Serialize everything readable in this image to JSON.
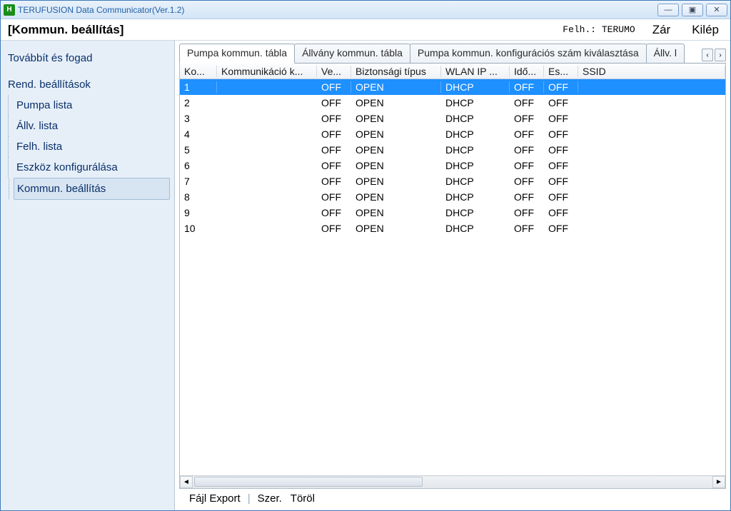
{
  "titlebar": {
    "app_icon_letter": "H",
    "title": "TERUFUSION Data Communicator(Ver.1.2)",
    "min": "—",
    "max": "▣",
    "close": "✕"
  },
  "header": {
    "heading": "[Kommun. beállítás]",
    "user_label": "Felh.: TERUMO",
    "close_btn": "Zár",
    "exit_btn": "Kilép"
  },
  "sidebar": {
    "group1": "Továbbít és fogad",
    "group2": "Rend. beállítások",
    "items": [
      {
        "label": "Pumpa lista"
      },
      {
        "label": "Állv. lista"
      },
      {
        "label": "Felh. lista"
      },
      {
        "label": "Eszköz konfigurálása"
      },
      {
        "label": "Kommun. beállítás"
      }
    ]
  },
  "tabs": {
    "t0": "Pumpa kommun. tábla",
    "t1": "Állvány kommun. tábla",
    "t2": "Pumpa kommun. konfigurációs szám kiválasztása",
    "t3": "Állv. l",
    "scroll_left": "‹",
    "scroll_right": "›"
  },
  "grid": {
    "headers": {
      "c0": "Ko...",
      "c1": "Kommunikáció k...",
      "c2": "Ve...",
      "c3": "Biztonsági típus",
      "c4": "WLAN IP ...",
      "c5": "Idő...",
      "c6": "Es...",
      "c7": "SSID"
    },
    "rows": [
      {
        "c0": "1",
        "c1": "",
        "c2": "OFF",
        "c3": "OPEN",
        "c4": "DHCP",
        "c5": "OFF",
        "c6": "OFF",
        "c7": ""
      },
      {
        "c0": "2",
        "c1": "",
        "c2": "OFF",
        "c3": "OPEN",
        "c4": "DHCP",
        "c5": "OFF",
        "c6": "OFF",
        "c7": ""
      },
      {
        "c0": "3",
        "c1": "",
        "c2": "OFF",
        "c3": "OPEN",
        "c4": "DHCP",
        "c5": "OFF",
        "c6": "OFF",
        "c7": ""
      },
      {
        "c0": "4",
        "c1": "",
        "c2": "OFF",
        "c3": "OPEN",
        "c4": "DHCP",
        "c5": "OFF",
        "c6": "OFF",
        "c7": ""
      },
      {
        "c0": "5",
        "c1": "",
        "c2": "OFF",
        "c3": "OPEN",
        "c4": "DHCP",
        "c5": "OFF",
        "c6": "OFF",
        "c7": ""
      },
      {
        "c0": "6",
        "c1": "",
        "c2": "OFF",
        "c3": "OPEN",
        "c4": "DHCP",
        "c5": "OFF",
        "c6": "OFF",
        "c7": ""
      },
      {
        "c0": "7",
        "c1": "",
        "c2": "OFF",
        "c3": "OPEN",
        "c4": "DHCP",
        "c5": "OFF",
        "c6": "OFF",
        "c7": ""
      },
      {
        "c0": "8",
        "c1": "",
        "c2": "OFF",
        "c3": "OPEN",
        "c4": "DHCP",
        "c5": "OFF",
        "c6": "OFF",
        "c7": ""
      },
      {
        "c0": "9",
        "c1": "",
        "c2": "OFF",
        "c3": "OPEN",
        "c4": "DHCP",
        "c5": "OFF",
        "c6": "OFF",
        "c7": ""
      },
      {
        "c0": "10",
        "c1": "",
        "c2": "OFF",
        "c3": "OPEN",
        "c4": "DHCP",
        "c5": "OFF",
        "c6": "OFF",
        "c7": ""
      }
    ]
  },
  "footer": {
    "export": "Fájl Export",
    "edit": "Szer.",
    "delete": "Töröl",
    "sep": "|"
  }
}
